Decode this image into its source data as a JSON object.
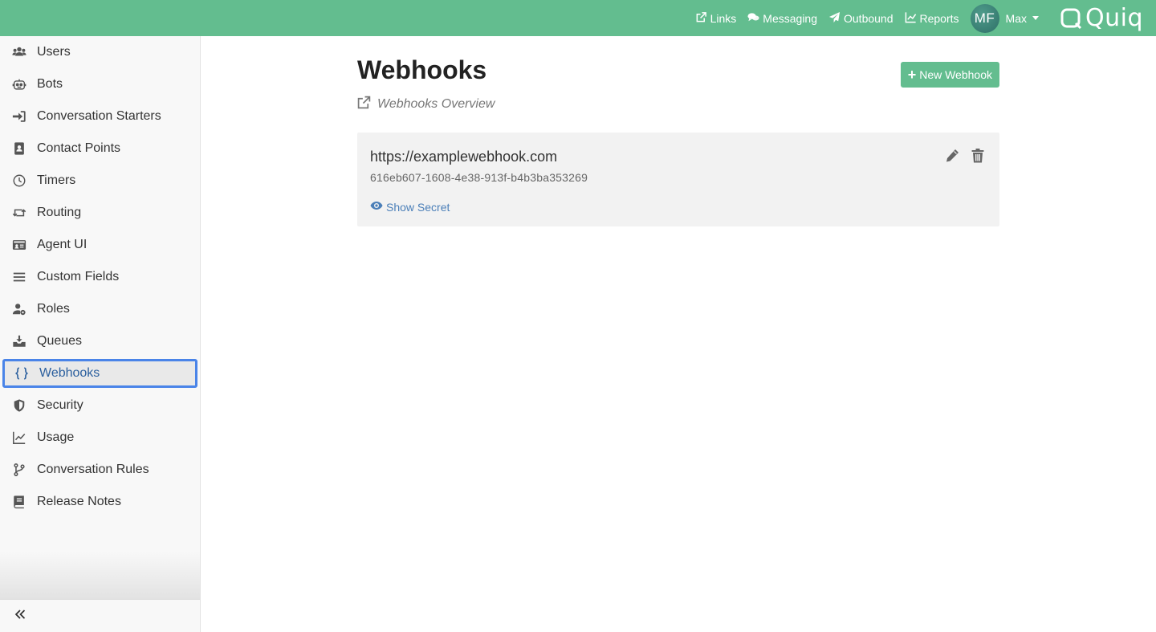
{
  "header": {
    "nav": [
      {
        "label": "Links",
        "icon": "external-link-icon"
      },
      {
        "label": "Messaging",
        "icon": "comments-icon"
      },
      {
        "label": "Outbound",
        "icon": "paper-plane-icon"
      },
      {
        "label": "Reports",
        "icon": "line-chart-icon"
      }
    ],
    "user": {
      "initials": "MF",
      "name": "Max"
    },
    "logo_text": "Quiq",
    "bar_color": "#63bd8f"
  },
  "sidebar": {
    "items": [
      {
        "label": "Users",
        "icon": "users-icon"
      },
      {
        "label": "Bots",
        "icon": "robot-icon"
      },
      {
        "label": "Conversation Starters",
        "icon": "sign-in-icon"
      },
      {
        "label": "Contact Points",
        "icon": "address-book-icon"
      },
      {
        "label": "Timers",
        "icon": "clock-icon"
      },
      {
        "label": "Routing",
        "icon": "retweet-icon"
      },
      {
        "label": "Agent UI",
        "icon": "id-card-icon"
      },
      {
        "label": "Custom Fields",
        "icon": "bars-icon"
      },
      {
        "label": "Roles",
        "icon": "user-cog-icon"
      },
      {
        "label": "Queues",
        "icon": "inbox-download-icon"
      },
      {
        "label": "Webhooks",
        "icon": "braces-icon"
      },
      {
        "label": "Security",
        "icon": "shield-icon"
      },
      {
        "label": "Usage",
        "icon": "area-chart-icon"
      },
      {
        "label": "Conversation Rules",
        "icon": "code-branch-icon"
      },
      {
        "label": "Release Notes",
        "icon": "book-icon"
      }
    ],
    "active": "Webhooks",
    "collapse_icon": "double-chevron-left-icon",
    "active_border_color": "#4a84e8"
  },
  "main": {
    "title": "Webhooks",
    "overview_link": "Webhooks Overview",
    "new_button": "New Webhook",
    "webhooks": [
      {
        "url": "https://examplewebhook.com",
        "id": "616eb607-1608-4e38-913f-b4b3ba353269",
        "show_secret": "Show Secret"
      }
    ]
  }
}
